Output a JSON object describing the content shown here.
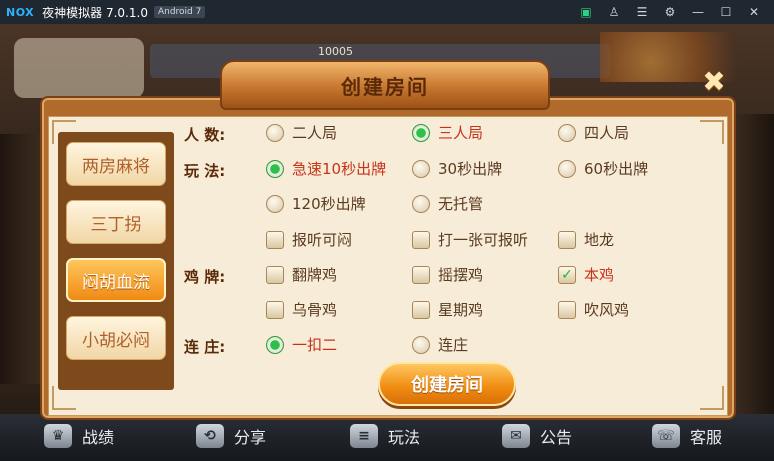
{
  "emulator": {
    "logo": "NOX",
    "title": "夜神模拟器 7.0.1.0",
    "android_badge": "Android 7",
    "controls": [
      "store-icon",
      "shirt-icon",
      "menu-icon",
      "settings-icon",
      "minimize-icon",
      "maximize-icon",
      "close-icon"
    ]
  },
  "background": {
    "counter": "10005"
  },
  "dialog": {
    "title": "创建房间",
    "close_icon": "close-icon",
    "tabs": [
      {
        "label": "两房麻将",
        "active": false
      },
      {
        "label": "三丁拐",
        "active": false
      },
      {
        "label": "闷胡血流",
        "active": true
      },
      {
        "label": "小胡必闷",
        "active": false
      }
    ],
    "players": {
      "label": "人  数:",
      "options": [
        {
          "label": "二人局",
          "selected": false
        },
        {
          "label": "三人局",
          "selected": true
        },
        {
          "label": "四人局",
          "selected": false
        }
      ]
    },
    "play": {
      "label": "玩  法:",
      "radio_options": [
        {
          "label": "急速10秒出牌",
          "selected": true
        },
        {
          "label": "30秒出牌",
          "selected": false
        },
        {
          "label": "60秒出牌",
          "selected": false
        },
        {
          "label": "120秒出牌",
          "selected": false
        },
        {
          "label": "无托管",
          "selected": false
        }
      ],
      "check_options": [
        {
          "label": "报听可闷",
          "checked": false
        },
        {
          "label": "打一张可报听",
          "checked": false
        },
        {
          "label": "地龙",
          "checked": false
        }
      ]
    },
    "chicken": {
      "label": "鸡  牌:",
      "options": [
        {
          "label": "翻牌鸡",
          "checked": false
        },
        {
          "label": "摇摆鸡",
          "checked": false
        },
        {
          "label": "本鸡",
          "checked": true
        },
        {
          "label": "乌骨鸡",
          "checked": false
        },
        {
          "label": "星期鸡",
          "checked": false
        },
        {
          "label": "吹风鸡",
          "checked": false
        }
      ]
    },
    "banker": {
      "label": "连  庄:",
      "options": [
        {
          "label": "一扣二",
          "selected": true
        },
        {
          "label": "连庄",
          "selected": false
        }
      ]
    },
    "create_button": "创建房间"
  },
  "bottom_nav": [
    {
      "label": "战绩",
      "icon": "trophy-icon"
    },
    {
      "label": "分享",
      "icon": "share-icon"
    },
    {
      "label": "玩法",
      "icon": "rules-icon"
    },
    {
      "label": "公告",
      "icon": "mail-icon"
    },
    {
      "label": "客服",
      "icon": "support-icon"
    }
  ]
}
